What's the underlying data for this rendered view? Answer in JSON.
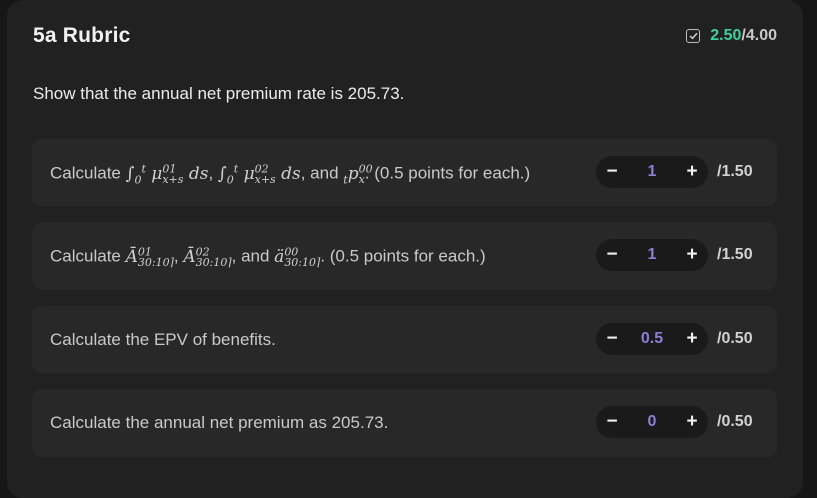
{
  "rubric": {
    "title": "5a Rubric",
    "score_earned": "2.50",
    "score_total": "/4.00",
    "question": "Show that the annual net premium rate is 205.73."
  },
  "items": [
    {
      "points": "1",
      "max": "/1.50",
      "label_prefix": "Calculate ",
      "label_sep1": ", ",
      "label_sep2": ", and ",
      "label_suffix": ". (0.5 points for each.)"
    },
    {
      "points": "1",
      "max": "/1.50",
      "label_prefix": "Calculate ",
      "label_sep1": ", ",
      "label_sep2": ", and ",
      "label_suffix": ". (0.5 points for each.)"
    },
    {
      "points": "0.5",
      "max": "/0.50",
      "label": "Calculate the EPV of benefits."
    },
    {
      "points": "0",
      "max": "/0.50",
      "label": "Calculate the annual net premium as 205.73."
    }
  ],
  "icons": {
    "score": "checkbox-checked-icon",
    "decrement": "minus-icon",
    "increment": "plus-icon"
  },
  "colors": {
    "earned": "#3ecf9e",
    "points": "#8b7fd6",
    "card": "#212121",
    "item": "#282828"
  }
}
